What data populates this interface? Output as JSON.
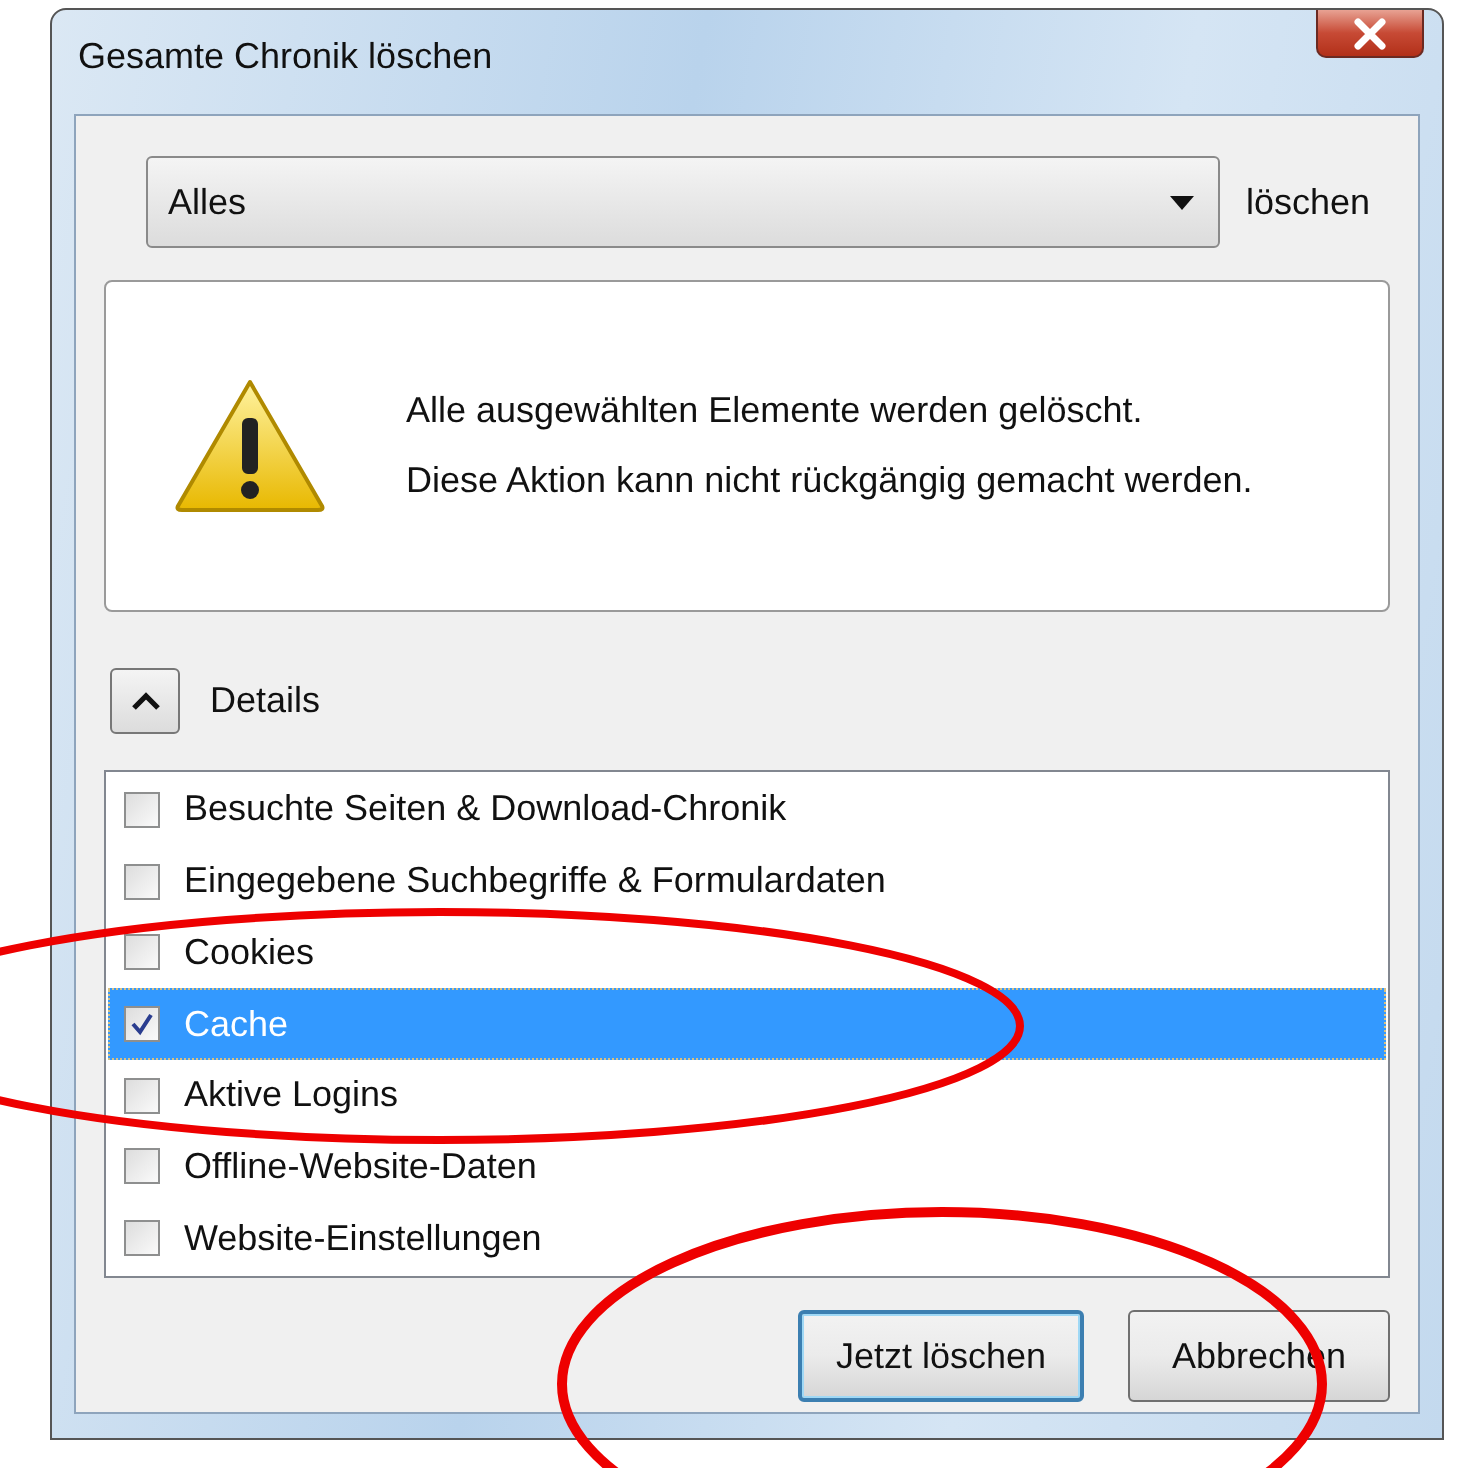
{
  "window": {
    "title": "Gesamte Chronik löschen"
  },
  "range": {
    "value": "Alles",
    "label": "löschen"
  },
  "warning": {
    "lines": [
      "Alle ausgewählten Elemente werden gelöscht.",
      "Diese Aktion kann nicht rückgängig gemacht werden."
    ]
  },
  "details": {
    "label": "Details",
    "expanded": true
  },
  "items": [
    {
      "label": "Besuchte Seiten & Download-Chronik",
      "checked": false,
      "selected": false
    },
    {
      "label": "Eingegebene Suchbegriffe & Formulardaten",
      "checked": false,
      "selected": false
    },
    {
      "label": "Cookies",
      "checked": false,
      "selected": false
    },
    {
      "label": "Cache",
      "checked": true,
      "selected": true
    },
    {
      "label": "Aktive Logins",
      "checked": false,
      "selected": false
    },
    {
      "label": "Offline-Website-Daten",
      "checked": false,
      "selected": false
    },
    {
      "label": "Website-Einstellungen",
      "checked": false,
      "selected": false
    }
  ],
  "buttons": [
    {
      "label": "Jetzt löschen",
      "default": true
    },
    {
      "label": "Abbrechen",
      "default": false
    }
  ]
}
